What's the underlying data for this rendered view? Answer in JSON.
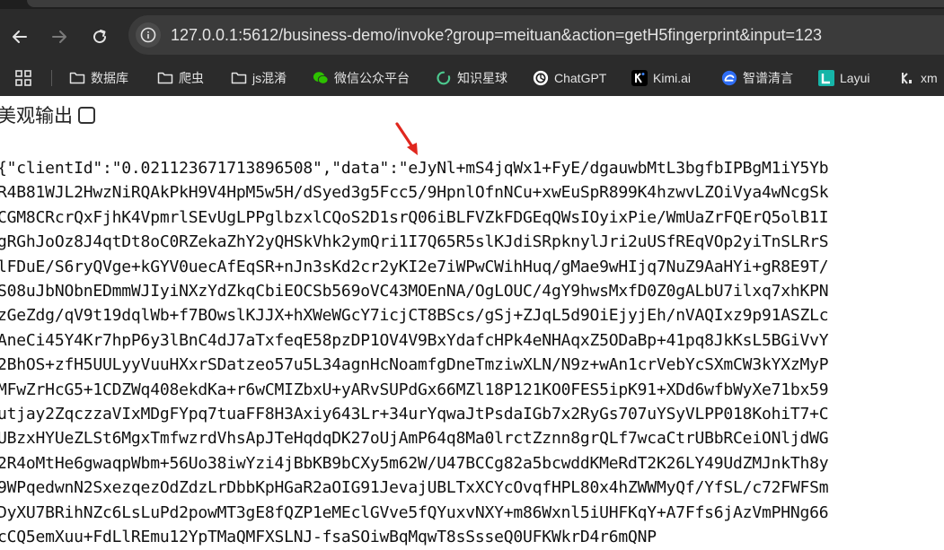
{
  "browser": {
    "url": "127.0.0.1:5612/business-demo/invoke?group=meituan&action=getH5fingerprint&input=123",
    "bookmarks": [
      {
        "label": "数据库",
        "icon": "folder-icon"
      },
      {
        "label": "爬虫",
        "icon": "folder-icon"
      },
      {
        "label": "js混淆",
        "icon": "folder-icon"
      },
      {
        "label": "微信公众平台",
        "icon": "wechat-icon"
      },
      {
        "label": "知识星球",
        "icon": "zsxq-icon"
      },
      {
        "label": "ChatGPT",
        "icon": "openai-icon"
      },
      {
        "label": "Kimi.ai",
        "icon": "kimi-icon"
      },
      {
        "label": "智谱清言",
        "icon": "zhipu-icon"
      },
      {
        "label": "Layui",
        "icon": "layui-icon"
      },
      {
        "label": "xm",
        "icon": "xm-icon"
      }
    ]
  },
  "page": {
    "pretty_label": "美观输出",
    "pretty_checked": false,
    "output_lines": [
      "{\"clientId\":\"0.021123671713896508\",\"data\":\"eJyNl+mS4jqWx1+FyE/dgauwbMtL3bgfbIPBgM1iY5Yb",
      "R4B81WJL2HwzNiRQAkPkH9V4HpM5w5H/dSyed3g5Fcc5/9HpnlOfnNCu+xwEuSpR899K4hzwvLZOiVya4wNcgSk",
      "CGM8CRcrQxFjhK4VpmrlSEvUgLPPglbzxlCQoS2D1srQ06iBLFVZkFDGEqQWsIOyixPie/WmUaZrFQErQ5olB1I",
      "gRGhJoOz8J4qtDt8oC0RZekaZhY2yQHSkVhk2ymQri1I7Q65R5slKJdiSRpknylJri2uUSfREqVOp2yiTnSLRrS",
      "lFDuE/S6ryQVge+kGYV0uecAfEqSR+nJn3sKd2cr2yKI2e7iWPwCWihHuq/gMae9wHIjq7NuZ9AaHYi+gR8E9T/",
      "S08uJbNObnEDmmWJIyiNXzYdZkqCbiEOCSb569oVC43MOEnNA/OgLOUC/4gY9hwsMxfD0Z0gALbU7ilxq7xhKPN",
      "zGeZdg/qV9t19dqlWb+f7BOwslKJJX+hXWeWGcY7icjCT8BScs/gSj+ZJqL5d9OiEjyjEh/nVAQIxz9p91ASZLc",
      "AneCi45Y4Kr7hpP6y3lBnC4dJ7aTxfeqE58pzDP1OV4V9BxYdafcHPk4eNHAqxZ5ODaBp+41pq8JkKsL5BGiVvY",
      "2BhOS+zfH5UULyyVuuHXxrSDatzeo57u5L34agnHcNoamfgDneTmziwXLN/N9z+wAn1crVebYcSXmCW3kYXzMyP",
      "MFwZrHcG5+1CDZWq408ekdKa+r6wCMIZbxU+yARvSUPdGx66MZl18P121KO0FES5ipK91+XDd6wfbWyXe71bx59",
      "utjay2ZqczzaVIxMDgFYpq7tuaFF8H3Axiy643Lr+34urYqwaJtPsdaIGb7x2RyGs707uYSyVLPP018KohiT7+C",
      "UBzxHYUeZLSt6MgxTmfwzrdVhsApJTeHqdqDK27oUjAmP64q8Ma0lrctZznn8grQLf7wcaCtrUBbRCeiONljdWG",
      "2R4oMtHe6gwaqpWbm+56Uo38iwYzi4jBbKB9bCXy5m62W/U47BCCg82a5bcwddKMeRdT2K26LY49UdZMJnkTh8y",
      "9WPqedwnN2SxezqezOdZdzLrDbbKpHGaR2aOIG91JevajUBLTxXCYcOvqfHPL80x4hZWWMyQf/YfSL/c72FWFSm",
      "DyXU7BRihNZc6LsLuPd2powMT3gE8fQZP1eMEclGVve5fQYuxvNXY+m86Wxnl5iUHFKqY+A7Ffs6jAzVmPHNg66",
      "cCQ5emXuu+FdLlREmu12YpTMaQMFXSLNJ-fsaSOiwBqMqwT8sSsseQ0UFKWkrD4r6mQNP"
    ]
  },
  "colors": {
    "chrome_bg": "#2b2b2b",
    "arrow": "#e0271e"
  }
}
